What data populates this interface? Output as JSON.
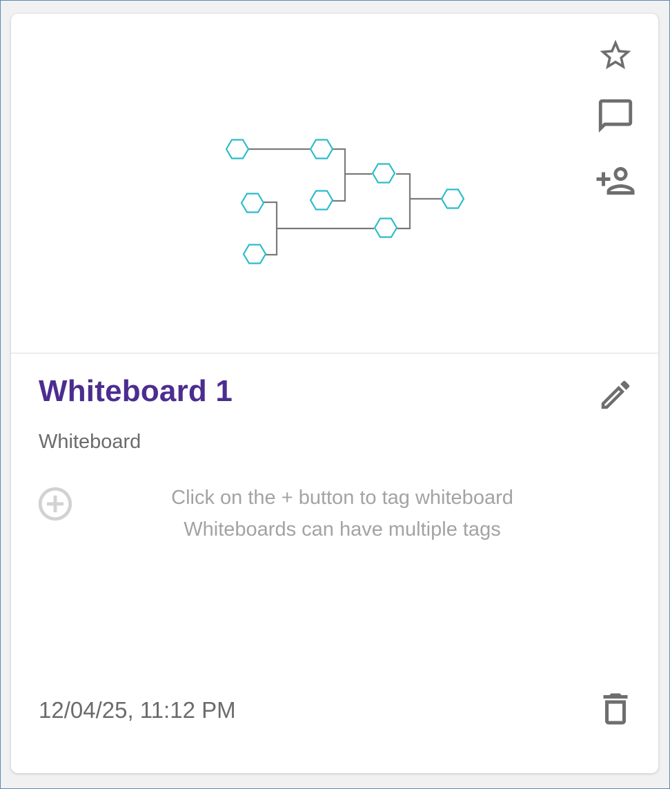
{
  "whiteboard": {
    "title": "Whiteboard 1",
    "type_label": "Whiteboard",
    "tag_hint_line1": "Click on the + button to tag whiteboard",
    "tag_hint_line2": "Whiteboards can have multiple tags",
    "date_modified": "12/04/25, 11:12 PM"
  },
  "actions": {
    "favorite_icon": "star-outline-icon",
    "comment_icon": "comment-icon",
    "share_icon": "person-add-icon",
    "edit_icon": "pencil-icon",
    "add_tag_icon": "add-circle-outline-icon",
    "delete_icon": "trash-icon"
  },
  "colors": {
    "title": "#4c2d8f",
    "node_stroke": "#2bbcc9",
    "connector": "#7a7a7a",
    "icon": "#6e6e6e",
    "hint_text": "#a3a3a3"
  }
}
